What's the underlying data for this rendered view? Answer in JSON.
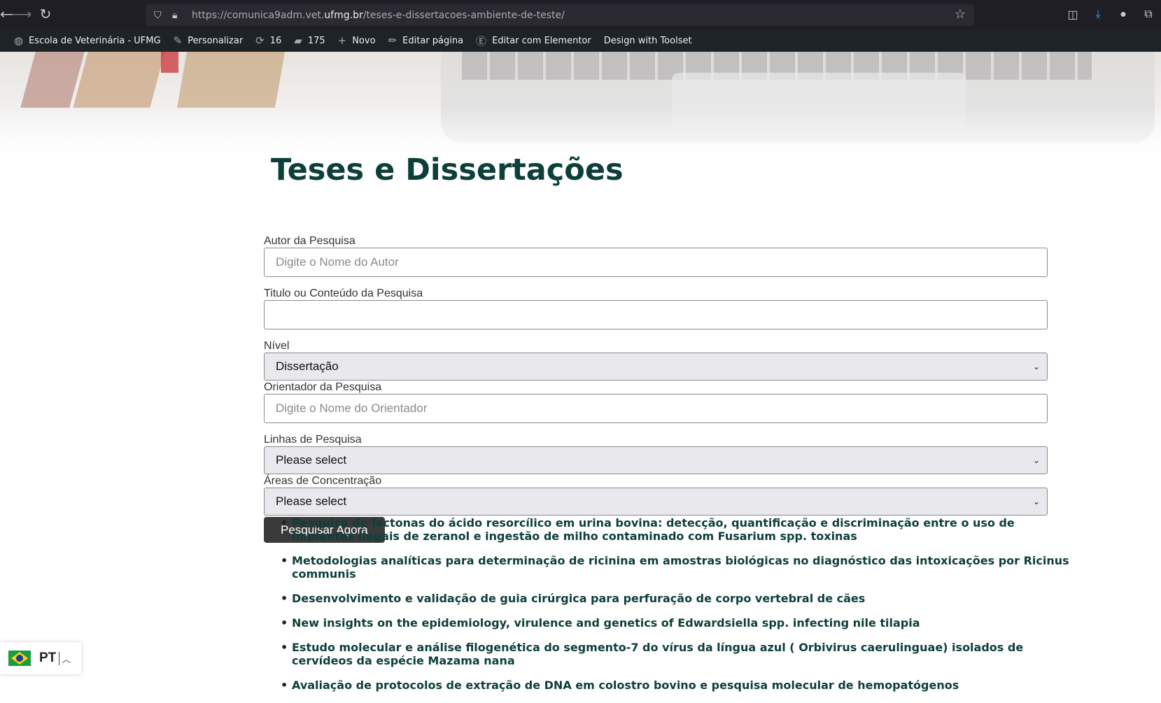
{
  "browser": {
    "url_prefix": "https://comunica9adm.vet.",
    "url_host": "ufmg.br",
    "url_path": "/teses-e-dissertacoes-ambiente-de-teste/"
  },
  "admin_bar": {
    "site": "Escola de Veterinária - UFMG",
    "customize": "Personalizar",
    "updates_count": "16",
    "comments_count": "175",
    "new": "Novo",
    "edit_page": "Editar página",
    "edit_elementor": "Editar com Elementor",
    "toolset": "Design with Toolset"
  },
  "page": {
    "title": "Teses e Dissertações"
  },
  "form": {
    "author": {
      "label": "Autor da Pesquisa",
      "placeholder": "Digite o Nome do Autor",
      "value": ""
    },
    "title_content": {
      "label": "Titulo ou Conteúdo da Pesquisa",
      "value": ""
    },
    "level": {
      "label": "Nível",
      "selected": "Dissertação"
    },
    "advisor": {
      "label": "Orientador da Pesquisa",
      "placeholder": "Digite o Nome do Orientador",
      "value": ""
    },
    "research_lines": {
      "label": "Linhas de Pesquisa",
      "selected": "Please select"
    },
    "concentration_areas": {
      "label": "Áreas de Concentração",
      "selected": "Please select"
    },
    "submit_label": "Pesquisar Agora"
  },
  "results": [
    "Pesquisa de lactonas do ácido resorcílico em urina bovina: detecção, quantificação e discriminação entre o uso de implantes ilegais de zeranol e ingestão de milho contaminado com Fusarium spp. toxinas",
    "Metodologias analíticas para determinação de ricinina em amostras biológicas no diagnóstico das intoxicações por Ricinus communis",
    "Desenvolvimento e validação de guia cirúrgica para perfuração de corpo vertebral de cães",
    "New insights on the epidemiology, virulence and genetics of Edwardsiella spp. infecting nile tilapia",
    "Estudo molecular e análise filogenética do segmento-7 do vírus da língua azul ( Orbivirus caerulinguae) isolados de cervídeos da espécie Mazama nana",
    "Avaliação de protocolos de extração de DNA em colostro bovino e pesquisa molecular de hemopatógenos"
  ],
  "language": {
    "code": "PT"
  },
  "colors": {
    "title": "#0c3f3a",
    "admin_bar": "#1d2327",
    "button": "#3a3a3a"
  }
}
